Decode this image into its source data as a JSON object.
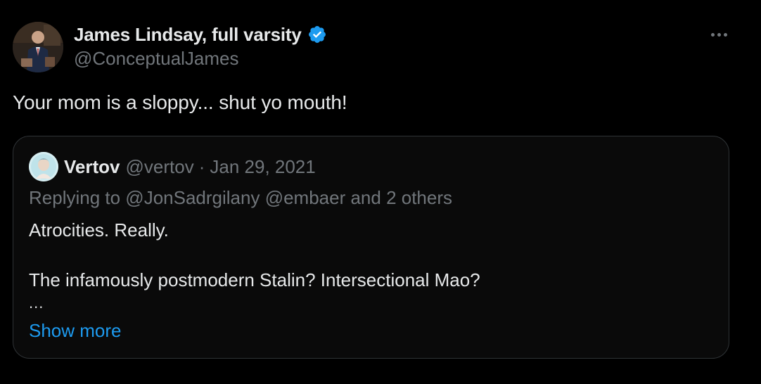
{
  "tweet": {
    "author": {
      "display_name": "James Lindsay, full varsity",
      "handle": "@ConceptualJames",
      "verified": true,
      "verified_color": "#1d9bf0"
    },
    "more_icon": "more-horizontal-icon",
    "text": "Your mom is a sloppy... shut yo mouth!"
  },
  "quote": {
    "author": {
      "display_name": "Vertov",
      "handle": "@vertov",
      "separator": "·",
      "date": "Jan 29, 2021"
    },
    "replying_to": "Replying to @JonSadrgilany @embaer and 2 others",
    "lines": [
      "Atrocities. Really.",
      "The infamously postmodern Stalin? Intersectional Mao?"
    ],
    "ellipsis": "...",
    "show_more": "Show more"
  },
  "colors": {
    "background": "#000000",
    "text_primary": "#e7e9ea",
    "text_secondary": "#71767b",
    "accent": "#1d9bf0",
    "border": "#2f3336"
  }
}
